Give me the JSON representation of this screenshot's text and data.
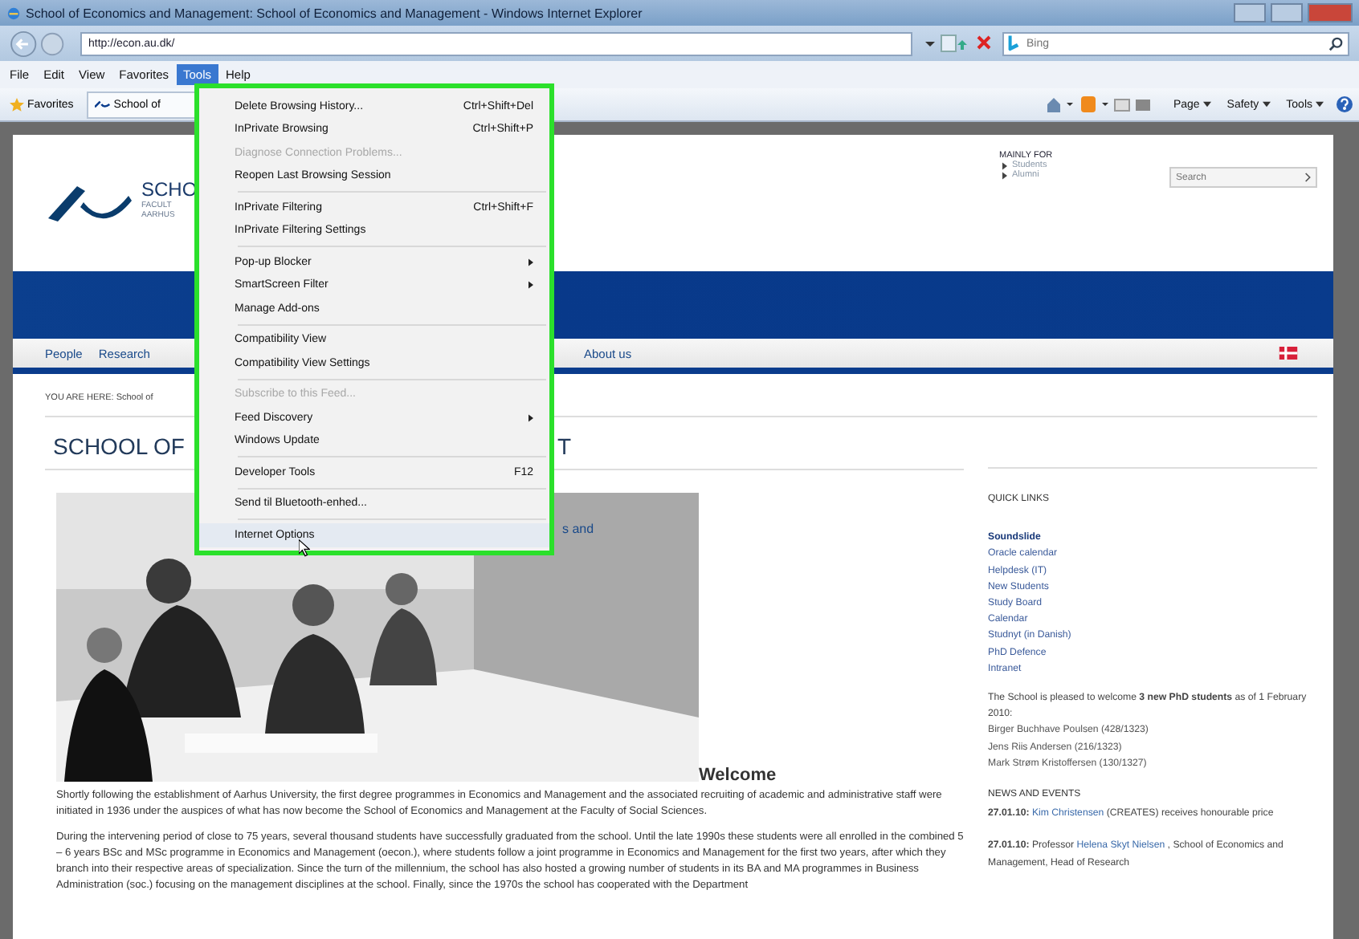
{
  "window": {
    "title": "School of Economics and Management: School of Economics and Management - Windows Internet Explorer"
  },
  "address_bar": {
    "url": "http://econ.au.dk/"
  },
  "search": {
    "placeholder": "Bing"
  },
  "menu_bar": [
    {
      "label": "File",
      "selected": false
    },
    {
      "label": "Edit",
      "selected": false
    },
    {
      "label": "View",
      "selected": false
    },
    {
      "label": "Favorites",
      "selected": false
    },
    {
      "label": "Tools",
      "selected": true
    },
    {
      "label": "Help",
      "selected": false
    }
  ],
  "favorites_bar": {
    "favorites": "Favorites",
    "tab": "School of"
  },
  "command_bar": [
    "Page",
    "Safety",
    "Tools"
  ],
  "tools_menu": [
    [
      {
        "label": "Delete Browsing History...",
        "shortcut": "Ctrl+Shift+Del",
        "disabled": false,
        "submenu": false,
        "highlighted": false
      },
      {
        "label": "InPrivate Browsing",
        "shortcut": "Ctrl+Shift+P",
        "disabled": false,
        "submenu": false,
        "highlighted": false
      },
      {
        "label": "Diagnose Connection Problems...",
        "disabled": true,
        "submenu": false,
        "highlighted": false
      },
      {
        "label": "Reopen Last Browsing Session",
        "disabled": false,
        "submenu": false,
        "highlighted": false
      }
    ],
    [
      {
        "label": "InPrivate Filtering",
        "shortcut": "Ctrl+Shift+F",
        "disabled": false,
        "submenu": false,
        "highlighted": false
      },
      {
        "label": "InPrivate Filtering Settings",
        "disabled": false,
        "submenu": false,
        "highlighted": false
      }
    ],
    [
      {
        "label": "Pop-up Blocker",
        "disabled": false,
        "submenu": true,
        "highlighted": false
      },
      {
        "label": "SmartScreen Filter",
        "disabled": false,
        "submenu": true,
        "highlighted": false
      },
      {
        "label": "Manage Add-ons",
        "disabled": false,
        "submenu": false,
        "highlighted": false
      }
    ],
    [
      {
        "label": "Compatibility View",
        "disabled": false,
        "submenu": false,
        "highlighted": false
      },
      {
        "label": "Compatibility View Settings",
        "disabled": false,
        "submenu": false,
        "highlighted": false
      }
    ],
    [
      {
        "label": "Subscribe to this Feed...",
        "disabled": true,
        "submenu": false,
        "highlighted": false
      },
      {
        "label": "Feed Discovery",
        "disabled": false,
        "submenu": true,
        "highlighted": false
      },
      {
        "label": "Windows Update",
        "disabled": false,
        "submenu": false,
        "highlighted": false
      }
    ],
    [
      {
        "label": "Developer Tools",
        "shortcut": "F12",
        "disabled": false,
        "submenu": false,
        "highlighted": false
      }
    ],
    [
      {
        "label": "Send til Bluetooth-enhed...",
        "disabled": false,
        "submenu": false,
        "highlighted": false
      }
    ],
    [
      {
        "label": "Internet Options",
        "disabled": false,
        "submenu": false,
        "highlighted": true
      }
    ]
  ],
  "site_header": {
    "title": "SCHO",
    "subtitle_lines": [
      "FACULT",
      "AARHUS"
    ],
    "mainly_for": "MAINLY FOR",
    "audiences": [
      "Students",
      "Alumni"
    ],
    "search_placeholder": "Search"
  },
  "nav": {
    "left": [
      "People",
      "Research"
    ],
    "right": [
      "About us"
    ]
  },
  "breadcrumb": "YOU ARE HERE: School of",
  "page_title": {
    "left": "SCHOOL OF",
    "right": "T"
  },
  "photo_caption": "s and",
  "welcome": {
    "heading": "Welcome",
    "paragraphs": [
      "Shortly following the establishment of Aarhus University, the first degree programmes in Economics and Management and the associated recruiting of academic and administrative staff were initiated in 1936 under the auspices of what has now become the School of Economics and Management at the Faculty of Social Sciences.",
      "During the intervening period of close to 75 years, several thousand students have successfully graduated from the school. Until the late 1990s these students were all enrolled in the combined 5 – 6 years BSc and MSc programme in Economics and Management (oecon.), where students follow a joint programme in Economics and Management for the first two years, after which they branch into their respective areas of specialization. Since the turn of the millennium, the school has also hosted a growing number of students in its BA and MA programmes in Business Administration (soc.) focusing on the management disciplines at the school. Finally, since the 1970s the school has cooperated with the Department"
    ]
  },
  "sidebar": {
    "quick_links_heading": "QUICK LINKS",
    "quick_links": [
      {
        "label": "Soundslide",
        "bold": true
      },
      {
        "label": "Oracle calendar",
        "bold": false
      },
      {
        "label": "Helpdesk (IT)",
        "bold": false
      },
      {
        "label": "New Students",
        "bold": false
      },
      {
        "label": "Study Board",
        "bold": false
      },
      {
        "label": "Calendar",
        "bold": false
      },
      {
        "label": "Studnyt (in Danish)",
        "bold": false
      },
      {
        "label": "PhD Defence",
        "bold": false
      },
      {
        "label": "Intranet",
        "bold": false
      }
    ],
    "announcement": "The School is pleased to welcome **3 new PhD students** as of 1 February 2010:",
    "phd_students": [
      "Birger Buchhave Poulsen (428/1323)",
      "Jens Riis Andersen (216/1323)",
      "Mark Strøm Kristoffersen (130/1327)"
    ],
    "news_heading": "NEWS AND EVENTS",
    "news": [
      {
        "date": "27.01.10:",
        "link": "Kim Christensen",
        "after": "(CREATES) receives honourable price"
      },
      {
        "date": "27.01.10:",
        "before": "Professor",
        "link": "Helena Skyt Nielsen",
        "after": ", School of Economics and Management, Head of Research"
      }
    ]
  }
}
